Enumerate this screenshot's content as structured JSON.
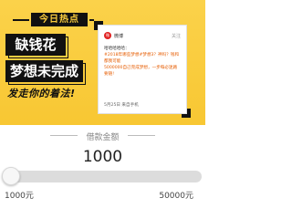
{
  "banner": {
    "tag": "今日热点",
    "headline_1": "缺钱花",
    "headline_2": "梦想未完成",
    "slogan": "发走你的着法!",
    "card": {
      "logo": "微",
      "brand": "微博",
      "more": "关注",
      "lines": [
        "哈哈哈哈哈：",
        "#2018年哪些梦想#梦想3？神吗？钱和都我可能",
        "5000000自己完成梦想，一步每必迷路要随!"
      ],
      "footer": "5月25日 来自手机"
    }
  },
  "loan": {
    "title": "借款金额",
    "amount": "1000",
    "min_label": "1000元",
    "max_label": "50000元",
    "slider_fraction": 0
  },
  "colors": {
    "banner_bg": "#f9cb3d",
    "ink": "#111111",
    "track": "#dcdcdc"
  }
}
